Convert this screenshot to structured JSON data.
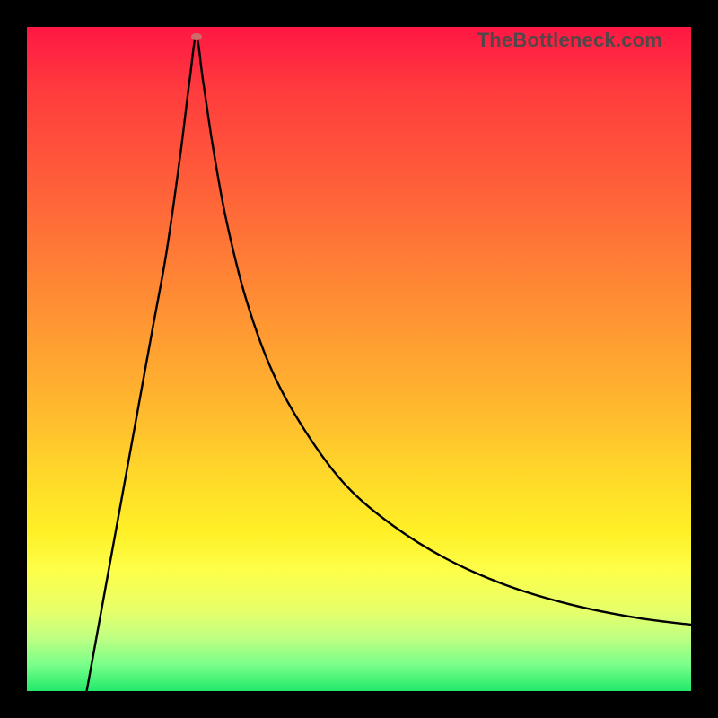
{
  "watermark": {
    "text": "TheBottleneck.com"
  },
  "gradient": {
    "top": "#ff1744",
    "mid_upper": "#ff9a32",
    "mid_lower": "#fff026",
    "bottom": "#22e96a"
  },
  "chart_data": {
    "type": "line",
    "title": "",
    "xlabel": "",
    "ylabel": "",
    "x_range": [
      0,
      100
    ],
    "y_range": [
      0,
      100
    ],
    "minimum_point": {
      "x": 25.5,
      "y": 98.5
    },
    "series": [
      {
        "name": "curve",
        "x": [
          9,
          11,
          13,
          15,
          17,
          19,
          21,
          23,
          24.5,
          25.5,
          26.5,
          28,
          30,
          33,
          37,
          42,
          48,
          55,
          63,
          72,
          82,
          92,
          100
        ],
        "y": [
          0,
          11,
          22,
          33,
          44,
          55,
          66,
          80,
          92,
          98.5,
          92,
          82,
          71,
          59,
          48,
          39,
          31,
          25,
          20,
          16,
          13,
          11,
          10
        ]
      }
    ],
    "annotations": [
      {
        "type": "ellipse",
        "x": 25.5,
        "y": 98.5,
        "color": "#d06a6a"
      }
    ]
  }
}
